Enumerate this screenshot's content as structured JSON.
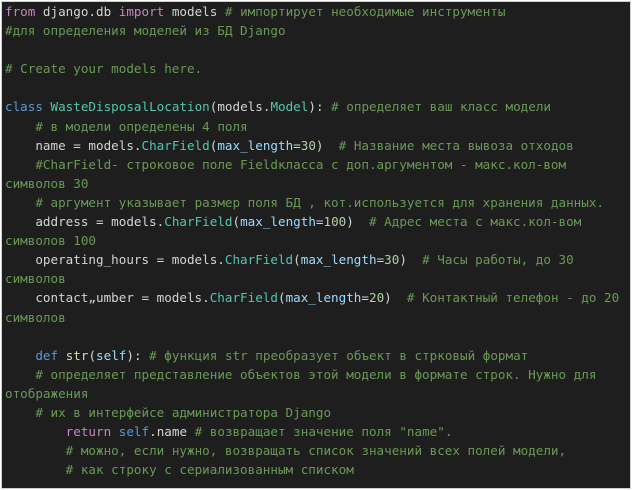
{
  "editor": {
    "colors": {
      "background": "#1e1e1e",
      "text": "#d4d4d4",
      "keyword_import": "#c586c0",
      "keyword": "#569cd6",
      "class_name": "#4ec9b0",
      "function": "#dcdcaa",
      "parameter": "#9cdcfe",
      "number": "#b5cea8",
      "string": "#ce9178",
      "comment": "#6a9955"
    },
    "lines": [
      {
        "tokens": [
          {
            "t": "from",
            "c": "kw-import"
          },
          {
            "t": " django.db ",
            "c": "txt"
          },
          {
            "t": "import",
            "c": "kw-import"
          },
          {
            "t": " models ",
            "c": "txt"
          },
          {
            "t": "# импортирует необходимые инструменты",
            "c": "com"
          }
        ]
      },
      {
        "tokens": [
          {
            "t": "#для определения моделей из БД Django",
            "c": "com"
          }
        ]
      },
      {
        "tokens": []
      },
      {
        "tokens": [
          {
            "t": "# Create your models here.",
            "c": "com"
          }
        ]
      },
      {
        "tokens": []
      },
      {
        "tokens": [
          {
            "t": "class",
            "c": "kw"
          },
          {
            "t": " ",
            "c": "txt"
          },
          {
            "t": "WasteDisposalLocation",
            "c": "cls"
          },
          {
            "t": "(",
            "c": "txt"
          },
          {
            "t": "models",
            "c": "txt"
          },
          {
            "t": ".",
            "c": "txt"
          },
          {
            "t": "Model",
            "c": "cls"
          },
          {
            "t": "): ",
            "c": "txt"
          },
          {
            "t": "# определяет ваш класс модели",
            "c": "com"
          }
        ]
      },
      {
        "tokens": [
          {
            "t": "    ",
            "c": "txt"
          },
          {
            "t": "# в модели определены 4 поля",
            "c": "com"
          }
        ]
      },
      {
        "tokens": [
          {
            "t": "    name = models.",
            "c": "txt"
          },
          {
            "t": "CharField",
            "c": "cls"
          },
          {
            "t": "(",
            "c": "txt"
          },
          {
            "t": "max_length",
            "c": "param"
          },
          {
            "t": "=",
            "c": "txt"
          },
          {
            "t": "30",
            "c": "num"
          },
          {
            "t": ")  ",
            "c": "txt"
          },
          {
            "t": "# Название места вывоза отходов",
            "c": "com"
          }
        ]
      },
      {
        "tokens": [
          {
            "t": "    ",
            "c": "txt"
          },
          {
            "t": "#CharField- строковое поле Fieldкласса с доп.аргументом - макс.кол-вом",
            "c": "com"
          }
        ]
      },
      {
        "tokens": [
          {
            "t": "символов 30",
            "c": "com"
          }
        ]
      },
      {
        "tokens": [
          {
            "t": "    ",
            "c": "txt"
          },
          {
            "t": "# аргумент указывает размер поля БД , кот.используется для хранения данных.",
            "c": "com"
          }
        ]
      },
      {
        "tokens": [
          {
            "t": "    address = models.",
            "c": "txt"
          },
          {
            "t": "CharField",
            "c": "cls"
          },
          {
            "t": "(",
            "c": "txt"
          },
          {
            "t": "max_length",
            "c": "param"
          },
          {
            "t": "=",
            "c": "txt"
          },
          {
            "t": "100",
            "c": "num"
          },
          {
            "t": ")  ",
            "c": "txt"
          },
          {
            "t": "# Адрес места с макс.кол-вом",
            "c": "com"
          }
        ]
      },
      {
        "tokens": [
          {
            "t": "символов 100",
            "c": "com"
          }
        ]
      },
      {
        "tokens": [
          {
            "t": "    operating_hours = models.",
            "c": "txt"
          },
          {
            "t": "CharField",
            "c": "cls"
          },
          {
            "t": "(",
            "c": "txt"
          },
          {
            "t": "max_length",
            "c": "param"
          },
          {
            "t": "=",
            "c": "txt"
          },
          {
            "t": "30",
            "c": "num"
          },
          {
            "t": ")  ",
            "c": "txt"
          },
          {
            "t": "# Часы работы, до 30",
            "c": "com"
          }
        ]
      },
      {
        "tokens": [
          {
            "t": "символов",
            "c": "com"
          }
        ]
      },
      {
        "tokens": [
          {
            "t": "    contact„umber = models.",
            "c": "txt"
          },
          {
            "t": "CharField",
            "c": "cls"
          },
          {
            "t": "(",
            "c": "txt"
          },
          {
            "t": "max_length",
            "c": "param"
          },
          {
            "t": "=",
            "c": "txt"
          },
          {
            "t": "20",
            "c": "num"
          },
          {
            "t": ")  ",
            "c": "txt"
          },
          {
            "t": "# Контактный телефон - до 20",
            "c": "com"
          }
        ]
      },
      {
        "tokens": [
          {
            "t": "символов",
            "c": "com"
          }
        ]
      },
      {
        "tokens": []
      },
      {
        "tokens": [
          {
            "t": "    ",
            "c": "txt"
          },
          {
            "t": "def",
            "c": "kw"
          },
          {
            "t": " ",
            "c": "txt"
          },
          {
            "t": "str",
            "c": "fn"
          },
          {
            "t": "(",
            "c": "txt"
          },
          {
            "t": "self",
            "c": "param"
          },
          {
            "t": "): ",
            "c": "txt"
          },
          {
            "t": "# функция str преобразует объект в стрковый формат",
            "c": "com"
          }
        ]
      },
      {
        "tokens": [
          {
            "t": "    ",
            "c": "txt"
          },
          {
            "t": "# определяет представление объектов этой модели в формате строк. Нужно для",
            "c": "com"
          }
        ]
      },
      {
        "tokens": [
          {
            "t": "отображения",
            "c": "com"
          }
        ]
      },
      {
        "tokens": [
          {
            "t": "    ",
            "c": "txt"
          },
          {
            "t": "# их в интерфейсе администратора Django",
            "c": "com"
          }
        ]
      },
      {
        "tokens": [
          {
            "t": "        ",
            "c": "txt"
          },
          {
            "t": "return",
            "c": "kw-import"
          },
          {
            "t": " ",
            "c": "txt"
          },
          {
            "t": "self",
            "c": "kw"
          },
          {
            "t": ".name ",
            "c": "txt"
          },
          {
            "t": "# возвращает значение поля \"name\".",
            "c": "com"
          }
        ]
      },
      {
        "tokens": [
          {
            "t": "        ",
            "c": "txt"
          },
          {
            "t": "# можно, если нужно, возвращать список значений всех полей модели,",
            "c": "com"
          }
        ]
      },
      {
        "tokens": [
          {
            "t": "        ",
            "c": "txt"
          },
          {
            "t": "# как строку с сериализованным списком",
            "c": "com"
          }
        ]
      }
    ]
  }
}
